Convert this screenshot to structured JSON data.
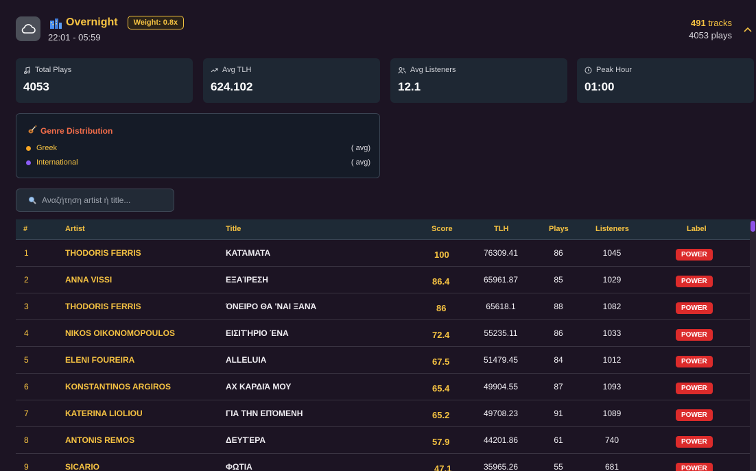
{
  "slot": {
    "name": "Overnight",
    "weight": "Weight: 0.8x",
    "time": "22:01 - 05:59",
    "tracks_count": "491",
    "tracks_unit": "tracks",
    "plays_line": "4053 plays"
  },
  "stats": [
    {
      "label": "Total Plays",
      "value": "4053",
      "icon": "music-note-icon"
    },
    {
      "label": "Avg TLH",
      "value": "624.102",
      "icon": "trending-up-icon"
    },
    {
      "label": "Avg Listeners",
      "value": "12.1",
      "icon": "users-icon"
    },
    {
      "label": "Peak Hour",
      "value": "01:00",
      "icon": "clock-icon"
    }
  ],
  "genre": {
    "title": "Genre Distribution",
    "items": [
      {
        "name": "Greek",
        "avg": "( avg)",
        "color": "#f5a524"
      },
      {
        "name": "International",
        "avg": "( avg)",
        "color": "#8b5cf6"
      }
    ]
  },
  "search": {
    "placeholder": "Αναζήτηση artist ή title..."
  },
  "table": {
    "headers": {
      "rank": "#",
      "artist": "Artist",
      "title": "Title",
      "score": "Score",
      "tlh": "TLH",
      "plays": "Plays",
      "listeners": "Listeners",
      "label": "Label"
    },
    "rows": [
      {
        "rank": "1",
        "artist": "THODORIS FERRIS",
        "title": "ΚΑΤΆΜΑΤΑ",
        "score": "100",
        "tlh": "76309.41",
        "plays": "86",
        "listeners": "1045",
        "label": "POWER"
      },
      {
        "rank": "2",
        "artist": "ANNA VISSI",
        "title": "ΕΞΑΊΡΕΣΗ",
        "score": "86.4",
        "tlh": "65961.87",
        "plays": "85",
        "listeners": "1029",
        "label": "POWER"
      },
      {
        "rank": "3",
        "artist": "THODORIS FERRIS",
        "title": "ΌΝΕΙΡΟ ΘΑ 'ΝΑΙ ΞΑΝΆ",
        "score": "86",
        "tlh": "65618.1",
        "plays": "88",
        "listeners": "1082",
        "label": "POWER"
      },
      {
        "rank": "4",
        "artist": "NIKOS OIKONOMOPOULOS",
        "title": "ΕΙΣΙΤΉΡΙΟ ΈΝΑ",
        "score": "72.4",
        "tlh": "55235.11",
        "plays": "86",
        "listeners": "1033",
        "label": "POWER"
      },
      {
        "rank": "5",
        "artist": "ELENI FOUREIRA",
        "title": "ALLELUIA",
        "score": "67.5",
        "tlh": "51479.45",
        "plays": "84",
        "listeners": "1012",
        "label": "POWER"
      },
      {
        "rank": "6",
        "artist": "KONSTANTINOS ARGIROS",
        "title": "ΑΧ ΚΑΡΔΙΆ ΜΟΥ",
        "score": "65.4",
        "tlh": "49904.55",
        "plays": "87",
        "listeners": "1093",
        "label": "POWER"
      },
      {
        "rank": "7",
        "artist": "KATERINA LIOLIOU",
        "title": "ΓΙΑ ΤΗΝ ΕΠΌΜΕΝΗ",
        "score": "65.2",
        "tlh": "49708.23",
        "plays": "91",
        "listeners": "1089",
        "label": "POWER"
      },
      {
        "rank": "8",
        "artist": "ANTONIS REMOS",
        "title": "ΔΕΥΤΈΡΑ",
        "score": "57.9",
        "tlh": "44201.86",
        "plays": "61",
        "listeners": "740",
        "label": "POWER"
      },
      {
        "rank": "9",
        "artist": "SICARIO",
        "title": "ΦΩΤΙΑ",
        "score": "47.1",
        "tlh": "35965.26",
        "plays": "55",
        "listeners": "681",
        "label": "POWER"
      }
    ]
  },
  "colors": {
    "accent": "#f5c242",
    "genre_title": "#f26d4a",
    "label_badge": "#dc2b2b",
    "scroll_thumb": "#8e52e8"
  }
}
